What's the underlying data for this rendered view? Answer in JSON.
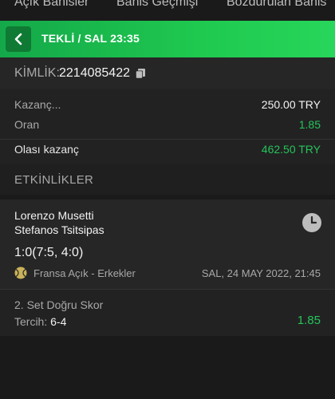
{
  "tabs": [
    {
      "label": "Açık Bahisler"
    },
    {
      "label": "Bahis Geçmişi"
    },
    {
      "label": "Bozdurulan Bahis"
    }
  ],
  "header": {
    "title": "TEKLİ / SAL 23:35"
  },
  "ticket": {
    "id_label": "KİMLİK:",
    "id_value": "2214085422"
  },
  "summary": {
    "kazanc_label": "Kazanç...",
    "kazanc_value": "250.00 TRY",
    "oran_label": "Oran",
    "oran_value": "1.85",
    "olasi_label": "Olası kazanç",
    "olasi_value": "462.50 TRY"
  },
  "events": {
    "title": "ETKİNLİKLER",
    "items": [
      {
        "player1": "Lorenzo Musetti",
        "player2": "Stefanos Tsitsipas",
        "score": "1:0(7:5, 4:0)",
        "tournament": "Fransa Açık - Erkekler",
        "date": "SAL, 24 MAY 2022, 21:45",
        "market": "2. Set Doğru Skor",
        "pick_label": "Tercih:",
        "pick_value": "6-4",
        "odds": "1.85"
      }
    ]
  },
  "icons": {
    "back": "chevron-left-icon",
    "copy": "copy-icon",
    "status": "clock-icon",
    "sport": "tennis-ball-icon"
  },
  "colors": {
    "accent": "#1fc94f",
    "odds_green": "#25c45a",
    "background": "#1a1a1a"
  }
}
